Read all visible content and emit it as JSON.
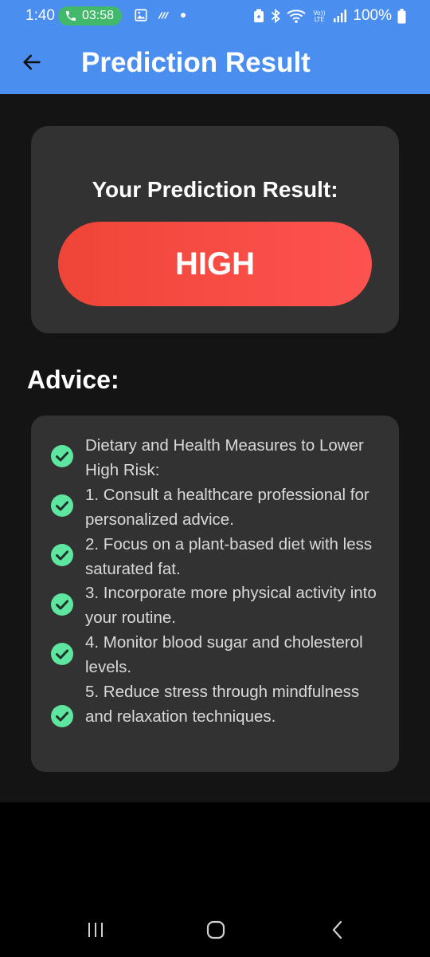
{
  "status_bar": {
    "time": "1:40",
    "call_timer": "03:58",
    "battery": "100%"
  },
  "app_bar": {
    "title": "Prediction Result",
    "background_color": "#4a8ef0"
  },
  "result": {
    "heading": "Your Prediction Result:",
    "value": "HIGH",
    "badge_color": "#f44a43"
  },
  "advice": {
    "heading": "Advice:",
    "lines": [
      "Dietary and Health Measures to Lower High Risk:",
      "1. Consult a healthcare professional for personalized advice.",
      "2. Focus on a plant-based diet with less saturated fat.",
      "3. Incorporate more physical activity into your routine.",
      "4. Monitor blood sugar and cholesterol levels.",
      "5. Reduce stress through mindfulness and relaxation techniques."
    ],
    "check_color": "#5ee6a0"
  },
  "navigation": {
    "buttons": [
      "recent-apps",
      "home",
      "back"
    ]
  }
}
